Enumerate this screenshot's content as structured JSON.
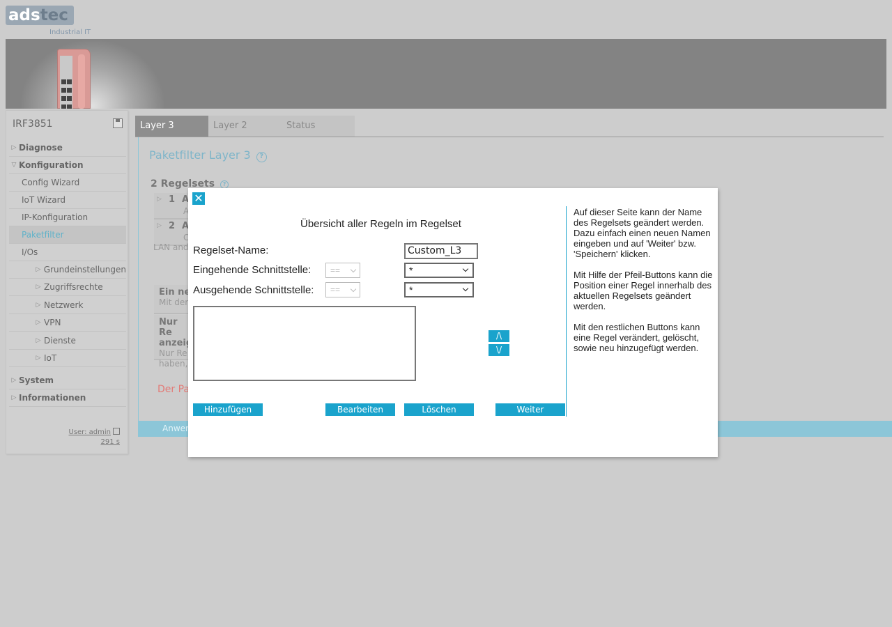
{
  "brand": {
    "logo_part1": "ads",
    "logo_part2": "tec",
    "tagline": "Industrial IT"
  },
  "sidebar": {
    "device_name": "IRF3851",
    "items": [
      {
        "label": "Diagnose",
        "level": 0,
        "expanded": false
      },
      {
        "label": "Konfiguration",
        "level": 0,
        "expanded": true
      },
      {
        "label": "Config Wizard",
        "level": 1
      },
      {
        "label": "IoT Wizard",
        "level": 1
      },
      {
        "label": "IP-Konfiguration",
        "level": 1
      },
      {
        "label": "Paketfilter",
        "level": 1,
        "active": true
      },
      {
        "label": "I/Os",
        "level": 1
      },
      {
        "label": "Grundeinstellungen",
        "level": 2
      },
      {
        "label": "Zugriffsrechte",
        "level": 2
      },
      {
        "label": "Netzwerk",
        "level": 2
      },
      {
        "label": "VPN",
        "level": 2
      },
      {
        "label": "Dienste",
        "level": 2
      },
      {
        "label": "IoT",
        "level": 2
      },
      {
        "label": "System",
        "level": 0,
        "expanded": false
      },
      {
        "label": "Informationen",
        "level": 0,
        "expanded": false
      }
    ],
    "user": "User: admin",
    "session_timer": "291 s"
  },
  "tabs": [
    {
      "label": "Layer 3",
      "active": true
    },
    {
      "label": "Layer 2",
      "active": false
    },
    {
      "label": "Status",
      "active": false
    }
  ],
  "main": {
    "title": "Paketfilter Layer 3",
    "ruleset_count": "2 Regelsets",
    "rulesets": [
      {
        "num": "1",
        "head": "A",
        "sub": "A"
      },
      {
        "num": "2",
        "head": "A",
        "sub": "C"
      }
    ],
    "lan_fragment": "LAN and",
    "info1_head": "Ein ne",
    "info1_text": "Mit der",
    "info2_head": "Nur Re anzeig",
    "info2_text": "Nur Re haben,",
    "warning": "Der Pa",
    "apply_label": "Anwen"
  },
  "modal": {
    "close_label": "✕",
    "title": "Übersicht aller Regeln im Regelset",
    "name_label": "Regelset-Name:",
    "name_value": "Custom_L3",
    "incoming_label": "Eingehende Schnittstelle:",
    "outgoing_label": "Ausgehende Schnittstelle:",
    "operator_value": "==",
    "incoming_value": "*",
    "outgoing_value": "*",
    "up_label": "/\\",
    "down_label": "\\/",
    "buttons": {
      "add": "Hinzufügen",
      "edit": "Bearbeiten",
      "delete": "Löschen",
      "next": "Weiter"
    },
    "help": [
      "Auf dieser Seite kann der Name des Regelsets geändert werden. Dazu einfach einen neuen Namen eingeben und auf 'Weiter' bzw. 'Speichern' klicken.",
      "Mit Hilfe der Pfeil-Buttons kann die Position einer Regel innerhalb des aktuellen Regelsets geändert werden.",
      "Mit den restlichen Buttons kann eine Regel verändert, gelöscht, sowie neu hinzugefügt werden."
    ]
  },
  "colors": {
    "accent": "#1aa3cc",
    "title": "#7fb5c9",
    "warning": "#e37b77",
    "banner": "#838383"
  }
}
